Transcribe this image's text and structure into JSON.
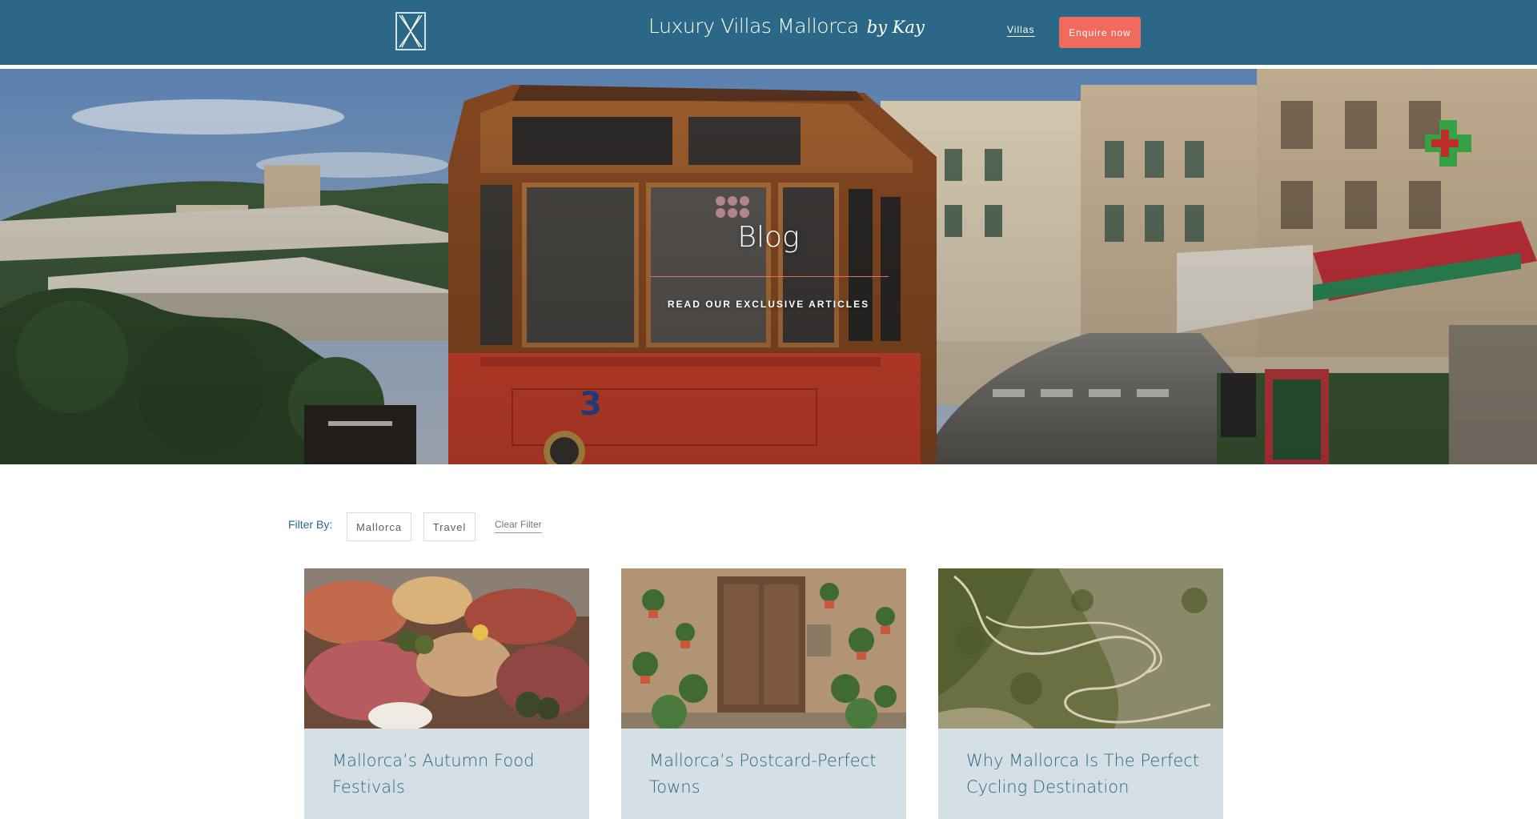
{
  "header": {
    "brand_name": "Luxury Villas Mallorca",
    "brand_suffix": "by Kay",
    "nav_villas": "Villas",
    "enquire_label": "Enquire now",
    "colors": {
      "bar": "#2b6786",
      "accent": "#f06a5d"
    }
  },
  "hero": {
    "title": "Blog",
    "subtitle": "READ OUR EXCLUSIVE ARTICLES"
  },
  "filter": {
    "label": "Filter By:",
    "tags": [
      "Mallorca",
      "Travel"
    ],
    "clear_label": "Clear Filter"
  },
  "articles": [
    {
      "title": "Mallorca’s Autumn Food Festivals"
    },
    {
      "title": "Mallorca’s Postcard-Perfect Towns"
    },
    {
      "title": "Why Mallorca Is The Perfect Cycling Destination"
    }
  ]
}
